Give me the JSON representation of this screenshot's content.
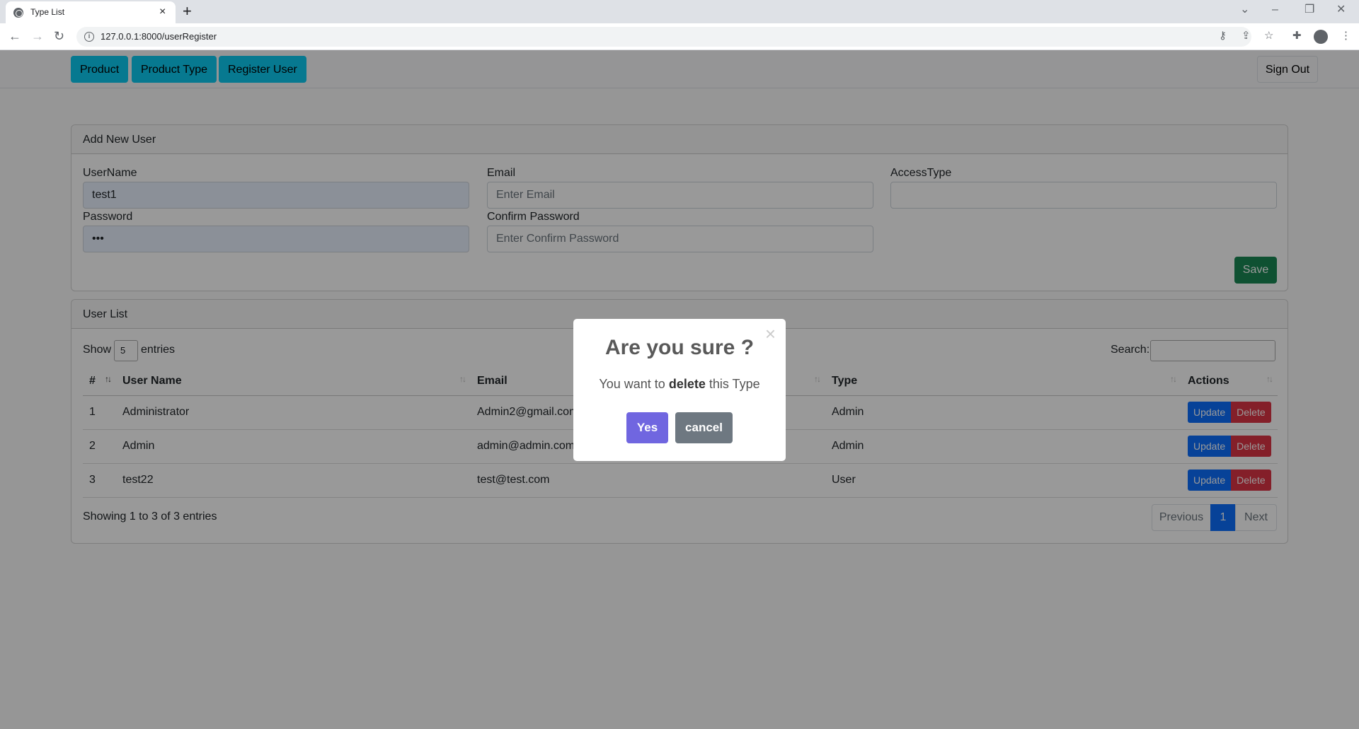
{
  "browser": {
    "tab_title": "Type List",
    "tab_close": "×",
    "new_tab": "+",
    "url": "127.0.0.1:8000/userRegister"
  },
  "navbar": {
    "links": [
      "Product",
      "Product Type",
      "Register User"
    ],
    "signout": "Sign Out"
  },
  "add_user": {
    "header": "Add New User",
    "username_label": "UserName",
    "username_value": "test1",
    "email_label": "Email",
    "email_placeholder": "Enter Email",
    "access_label": "AccessType",
    "password_label": "Password",
    "password_value": "•••",
    "confirm_label": "Confirm Password",
    "confirm_placeholder": "Enter Confirm Password",
    "save": "Save"
  },
  "user_list": {
    "header": "User List",
    "show": "Show",
    "entries_count": "5",
    "entries": "entries",
    "search": "Search:",
    "columns": [
      "#",
      "User Name",
      "Email",
      "Type",
      "Actions"
    ],
    "rows": [
      {
        "num": "1",
        "name": "Administrator",
        "email": "Admin2@gmail.com",
        "type": "Admin"
      },
      {
        "num": "2",
        "name": "Admin",
        "email": "admin@admin.com",
        "type": "Admin"
      },
      {
        "num": "3",
        "name": "test22",
        "email": "test@test.com",
        "type": "User"
      }
    ],
    "update": "Update",
    "delete": "Delete",
    "info": "Showing 1 to 3 of 3 entries",
    "prev": "Previous",
    "page": "1",
    "next": "Next"
  },
  "modal": {
    "title": "Are you sure ?",
    "text_pre": "You want to",
    "text_bold": "delete",
    "text_post": "this Type",
    "yes": "Yes",
    "cancel": "cancel",
    "close": "×"
  }
}
